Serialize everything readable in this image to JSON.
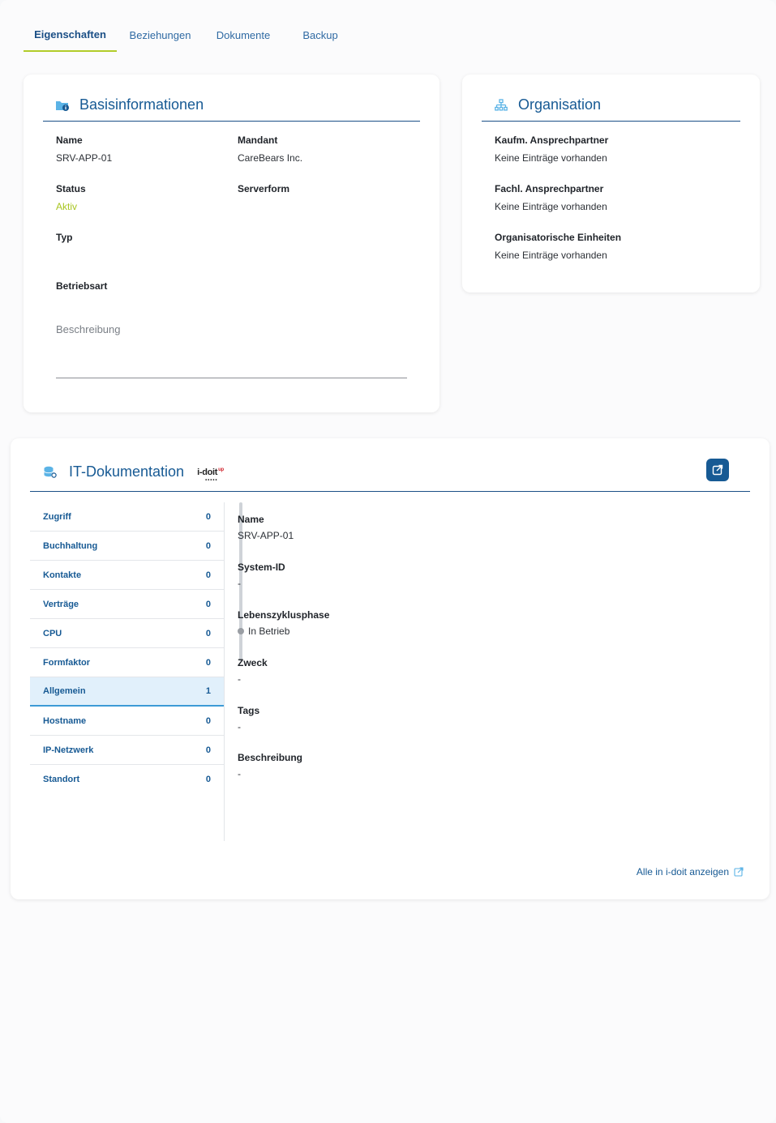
{
  "tabs": [
    {
      "label": "Eigenschaften",
      "active": true
    },
    {
      "label": "Beziehungen",
      "active": false
    },
    {
      "label": "Dokumente",
      "active": false
    },
    {
      "label": "Backup",
      "active": false
    }
  ],
  "basis": {
    "title": "Basisinformationen",
    "name_label": "Name",
    "name_value": "SRV-APP-01",
    "mandant_label": "Mandant",
    "mandant_value": "CareBears Inc.",
    "status_label": "Status",
    "status_value": "Aktiv",
    "serverform_label": "Serverform",
    "typ_label": "Typ",
    "betriebsart_label": "Betriebsart",
    "beschreibung_placeholder": "Beschreibung"
  },
  "organisation": {
    "title": "Organisation",
    "fields": [
      {
        "label": "Kaufm. Ansprechpartner",
        "value": "Keine Einträge vorhanden"
      },
      {
        "label": "Fachl. Ansprechpartner",
        "value": "Keine Einträge vorhanden"
      },
      {
        "label": "Organisatorische Einheiten",
        "value": "Keine Einträge vorhanden"
      }
    ]
  },
  "itdoku": {
    "title": "IT-Dokumentation",
    "logo_text": "i-doit",
    "logo_superscript": "up",
    "categories": [
      {
        "label": "Zugriff",
        "count": "0"
      },
      {
        "label": "Buchhaltung",
        "count": "0"
      },
      {
        "label": "Kontakte",
        "count": "0"
      },
      {
        "label": "Verträge",
        "count": "0"
      },
      {
        "label": "CPU",
        "count": "0"
      },
      {
        "label": "Formfaktor",
        "count": "0"
      },
      {
        "label": "Allgemein",
        "count": "1"
      },
      {
        "label": "Hostname",
        "count": "0"
      },
      {
        "label": "IP-Netzwerk",
        "count": "0"
      },
      {
        "label": "Standort",
        "count": "0"
      }
    ],
    "details": [
      {
        "label": "Name",
        "value": "SRV-APP-01"
      },
      {
        "label": "System-ID",
        "value": "-"
      },
      {
        "label": "Lebenszyklusphase",
        "value": "In Betrieb"
      },
      {
        "label": "Zweck",
        "value": "-"
      },
      {
        "label": "Tags",
        "value": "-"
      },
      {
        "label": "Beschreibung",
        "value": "-"
      }
    ],
    "all_link": "Alle in i-doit anzeigen"
  },
  "colors": {
    "primary": "#175a94",
    "accent_tab": "#b2cc2a",
    "status_active": "#a8c520",
    "icon_light": "#5bb3e6"
  }
}
